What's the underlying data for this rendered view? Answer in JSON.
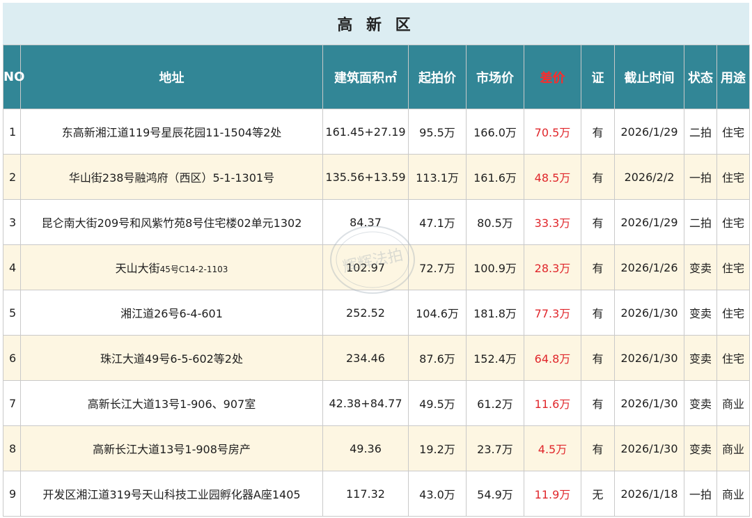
{
  "title": "高 新 区",
  "headers": {
    "no": "NO",
    "address": "地址",
    "area": "建筑面积㎡",
    "start_price": "起拍价",
    "market_price": "市场价",
    "diff": "差价",
    "cert": "证",
    "deadline": "截止时间",
    "status": "状态",
    "usage": "用途"
  },
  "rows": [
    {
      "no": "1",
      "address": "东高新湘江道119号星辰花园11-1504等2处",
      "area": "161.45+27.19",
      "start_price": "95.5万",
      "market_price": "166.0万",
      "diff": "70.5万",
      "cert": "有",
      "deadline": "2026/1/29",
      "status": "二拍",
      "usage": "住宅"
    },
    {
      "no": "2",
      "address": "华山街238号融鸿府（西区）5-1-1301号",
      "area": "135.56+13.59",
      "start_price": "113.1万",
      "market_price": "161.6万",
      "diff": "48.5万",
      "cert": "有",
      "deadline": "2026/2/2",
      "status": "一拍",
      "usage": "住宅"
    },
    {
      "no": "3",
      "address": "昆仑南大街209号和风紫竹苑8号住宅楼02单元1302",
      "area": "84.37",
      "start_price": "47.1万",
      "market_price": "80.5万",
      "diff": "33.3万",
      "cert": "有",
      "deadline": "2026/1/29",
      "status": "二拍",
      "usage": "住宅"
    },
    {
      "no": "4",
      "address_main": "天山大街",
      "address_small": "45号C14-2-1103",
      "area": "102.97",
      "start_price": "72.7万",
      "market_price": "100.9万",
      "diff": "28.3万",
      "cert": "有",
      "deadline": "2026/1/26",
      "status": "变卖",
      "usage": "住宅"
    },
    {
      "no": "5",
      "address": "湘江道26号6-4-601",
      "area": "252.52",
      "start_price": "104.6万",
      "market_price": "181.8万",
      "diff": "77.3万",
      "cert": "有",
      "deadline": "2026/1/30",
      "status": "变卖",
      "usage": "住宅"
    },
    {
      "no": "6",
      "address": "珠江大道49号6-5-602等2处",
      "area": "234.46",
      "start_price": "87.6万",
      "market_price": "152.4万",
      "diff": "64.8万",
      "cert": "有",
      "deadline": "2026/1/30",
      "status": "变卖",
      "usage": "住宅"
    },
    {
      "no": "7",
      "address": "高新长江大道13号1-906、907室",
      "area": "42.38+84.77",
      "start_price": "49.5万",
      "market_price": "61.2万",
      "diff": "11.6万",
      "cert": "有",
      "deadline": "2026/1/30",
      "status": "变卖",
      "usage": "商业"
    },
    {
      "no": "8",
      "address": "高新长江大道13号1-908号房产",
      "area": "49.36",
      "start_price": "19.2万",
      "market_price": "23.7万",
      "diff": "4.5万",
      "cert": "有",
      "deadline": "2026/1/30",
      "status": "变卖",
      "usage": "商业"
    },
    {
      "no": "9",
      "address": "开发区湘江道319号天山科技工业园孵化器A座1405",
      "area": "117.32",
      "start_price": "43.0万",
      "market_price": "54.9万",
      "diff": "11.9万",
      "cert": "无",
      "deadline": "2026/1/18",
      "status": "一拍",
      "usage": "商业"
    }
  ],
  "watermark": "辉辉法拍",
  "colors": {
    "title_bg": "#dcedf2",
    "header_bg": "#328696",
    "alt_row_bg": "#fdf6e2",
    "diff_text": "#e0262b"
  }
}
